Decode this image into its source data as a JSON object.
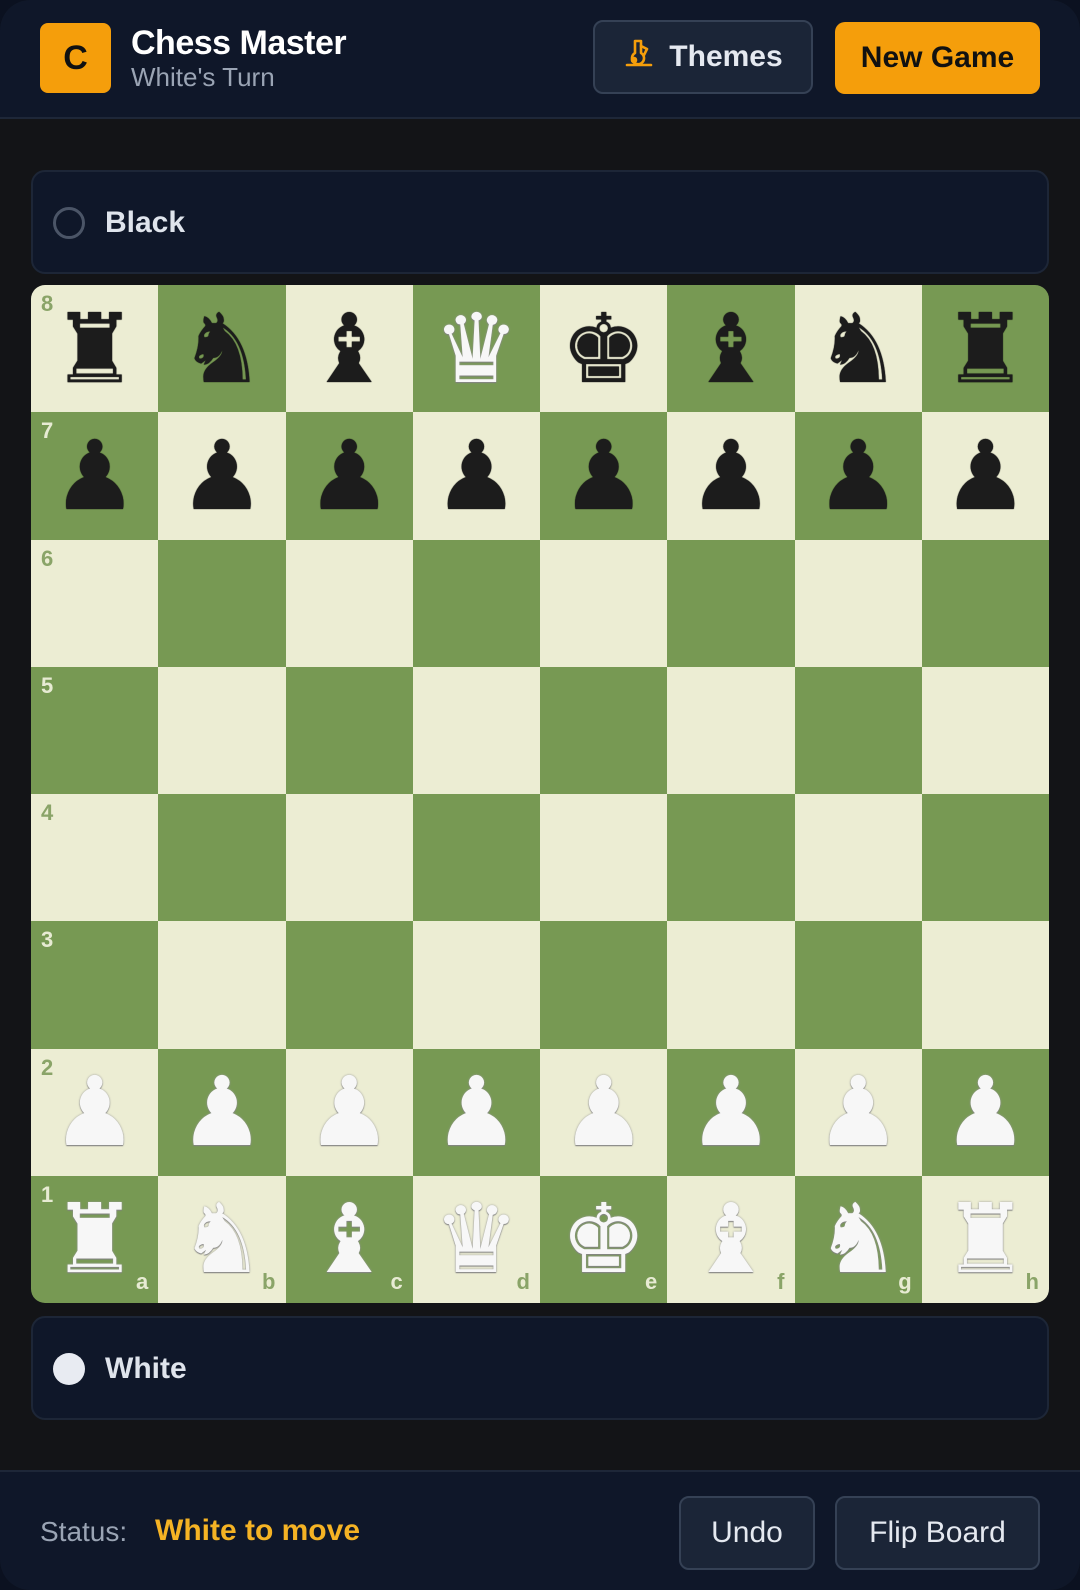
{
  "header": {
    "logo_letter": "C",
    "title": "Chess Master",
    "turn_text": "White's Turn",
    "themes_label": "Themes",
    "themes_icon": "palette-icon",
    "new_game_label": "New Game"
  },
  "players": {
    "top": {
      "name": "Black",
      "color": "black"
    },
    "bottom": {
      "name": "White",
      "color": "white"
    }
  },
  "board": {
    "files": [
      "a",
      "b",
      "c",
      "d",
      "e",
      "f",
      "g",
      "h"
    ],
    "ranks": [
      "8",
      "7",
      "6",
      "5",
      "4",
      "3",
      "2",
      "1"
    ],
    "position": [
      [
        "br",
        "bn",
        "bb",
        "wq",
        "bk",
        "bb",
        "bn",
        "br"
      ],
      [
        "bp",
        "bp",
        "bp",
        "bp",
        "bp",
        "bp",
        "bp",
        "bp"
      ],
      [
        "",
        "",
        "",
        "",
        "",
        "",
        "",
        ""
      ],
      [
        "",
        "",
        "",
        "",
        "",
        "",
        "",
        ""
      ],
      [
        "",
        "",
        "",
        "",
        "",
        "",
        "",
        ""
      ],
      [
        "",
        "",
        "",
        "",
        "",
        "",
        "",
        ""
      ],
      [
        "wp",
        "wp",
        "wp",
        "wp",
        "wp",
        "wp",
        "wp",
        "wp"
      ],
      [
        "wr",
        "wn",
        "wb",
        "wq",
        "wk",
        "wb",
        "wn",
        "wr"
      ]
    ],
    "light_color": "#ecedd3",
    "dark_color": "#779953"
  },
  "footer": {
    "status_label": "Status:",
    "status_value": "White to move",
    "undo_label": "Undo",
    "flip_label": "Flip Board"
  },
  "colors": {
    "accent": "#f59e0b",
    "status_text": "#f5b324",
    "panel_bg": "#0f1729"
  }
}
